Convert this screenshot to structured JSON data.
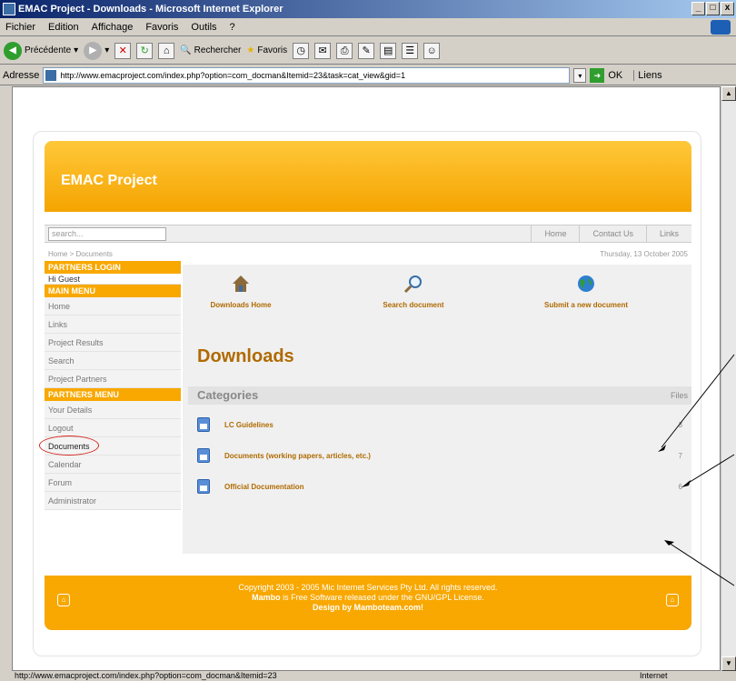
{
  "window": {
    "title": "EMAC Project - Downloads - Microsoft Internet Explorer",
    "buttons": [
      "_",
      "□",
      "x"
    ]
  },
  "menubar": [
    "Fichier",
    "Edition",
    "Affichage",
    "Favoris",
    "Outils",
    "?"
  ],
  "toolbar": {
    "back_label": "Précédente",
    "search_label": "Rechercher",
    "favorites_label": "Favoris"
  },
  "addressbar": {
    "label": "Adresse",
    "url": "http://www.emacproject.com/index.php?option=com_docman&Itemid=23&task=cat_view&gid=1",
    "go_label": "OK",
    "links_label": "Liens"
  },
  "site": {
    "logo": "EMAC Project",
    "search_placeholder": "search...",
    "top_links": [
      "Home",
      "Contact Us",
      "Links"
    ],
    "breadcrumb": "Home > Documents",
    "date": "Thursday, 13 October 2005"
  },
  "sidebar": {
    "partners_login": "PARTNERS LOGIN",
    "hi_user": "Hi Guest",
    "main_menu": "MAIN MENU",
    "main_items": [
      "Home",
      "Links",
      "Project Results",
      "Search",
      "Project Partners"
    ],
    "partners_menu": "PARTNERS MENU",
    "partner_items": [
      "Your Details",
      "Logout",
      "Documents",
      "Calendar",
      "Forum",
      "Administrator"
    ]
  },
  "main": {
    "icons": [
      "Downloads Home",
      "Search document",
      "Submit a new document"
    ],
    "title": "Downloads",
    "categories_label": "Categories",
    "files_label": "Files",
    "categories": [
      {
        "name": "LC Guidelines",
        "count": "3"
      },
      {
        "name": "Documents (working papers, articles, etc.)",
        "count": "7"
      },
      {
        "name": "Official Documentation",
        "count": "6"
      }
    ]
  },
  "footer": {
    "line1": "Copyright 2003 - 2005 Mic Internet Services Pty Ltd. All rights reserved.",
    "line2_brand": "Mambo",
    "line2_rest": " is Free Software released under the GNU/GPL License.",
    "line3": "Design by Mamboteam.com!"
  },
  "statusbar": {
    "url": "http://www.emacproject.com/index.php?option=com_docman&Itemid=23",
    "zone": "Internet"
  }
}
